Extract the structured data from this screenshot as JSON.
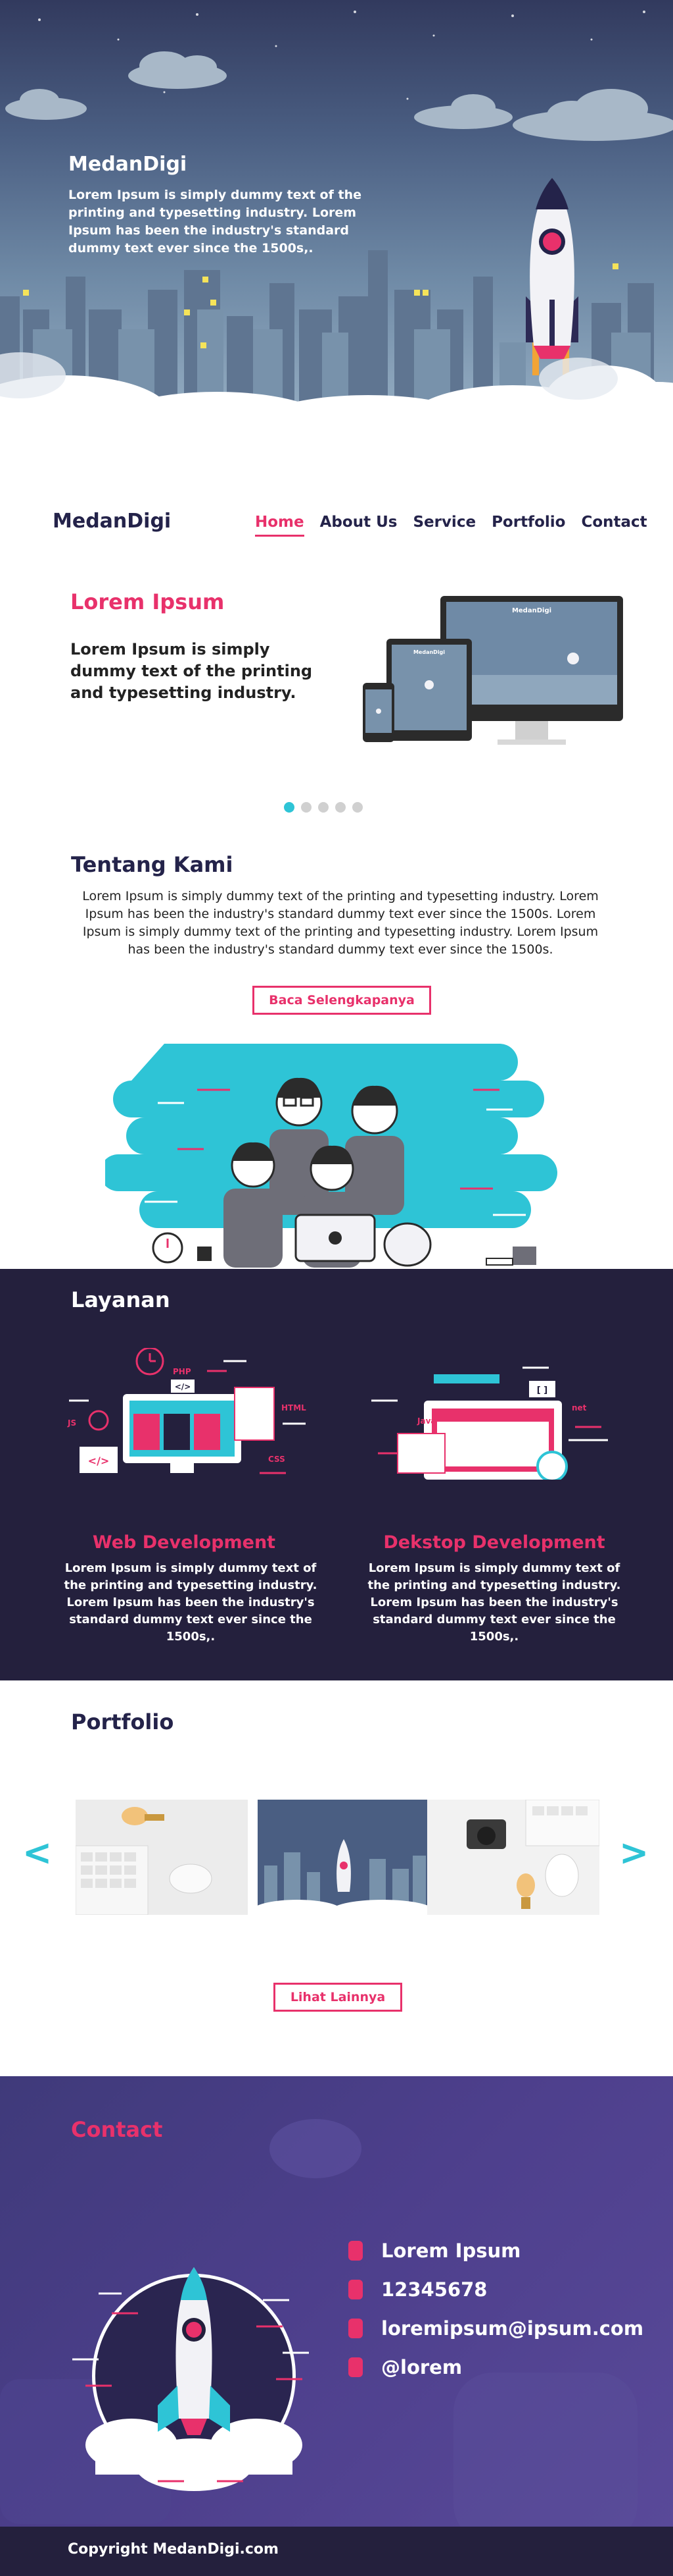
{
  "hero": {
    "brand": "MedanDigi",
    "text": "Lorem Ipsum is simply dummy text of the printing and typesetting industry. Lorem Ipsum has been the industry's standard dummy text ever since the 1500s,."
  },
  "nav": {
    "logo": "MedanDigi",
    "items": [
      "Home",
      "About Us",
      "Service",
      "Portfolio",
      "Contact"
    ],
    "active": "Home"
  },
  "slider": {
    "title": "Lorem Ipsum",
    "text": "Lorem Ipsum is simply dummy text of the printing and typesetting industry.",
    "slide_count": 5,
    "active_slide": 1,
    "device_screen_title": "MedanDigi"
  },
  "about": {
    "title": "Tentang Kami",
    "text": "Lorem Ipsum is simply dummy text of the printing and typesetting industry. Lorem Ipsum has been the industry's standard dummy text ever since the 1500s. Lorem Ipsum is simply dummy text of the printing and typesetting industry. Lorem Ipsum has been the industry's standard dummy text ever since the 1500s.",
    "button": "Baca Selengkapanya"
  },
  "services": {
    "title": "Layanan",
    "items": [
      {
        "title": "Web Development",
        "text": "Lorem Ipsum is simply dummy text of the printing and typesetting industry. Lorem Ipsum has been the industry's standard dummy text ever since the 1500s,.",
        "tags": [
          "PHP",
          "HTML",
          "JS",
          "CSS",
          "</>"
        ]
      },
      {
        "title": "Dekstop Development",
        "text": "Lorem Ipsum is simply dummy text of the printing and typesetting industry. Lorem Ipsum has been the industry's standard dummy text ever since the 1500s,.",
        "tags": [
          "net",
          "Java",
          "[ ]"
        ]
      }
    ]
  },
  "portfolio": {
    "title": "Portfolio",
    "prev": "<",
    "next": ">",
    "button": "Lihat Lainnya"
  },
  "contact": {
    "title": "Contact",
    "items": [
      "Lorem Ipsum",
      "12345678",
      "loremipsum@ipsum.com",
      "@lorem"
    ]
  },
  "footer": {
    "copyright": "Copyright MedanDigi.com"
  },
  "colors": {
    "accent": "#e8316b",
    "dark": "#24203d",
    "navy": "#24234a",
    "teal": "#2ec4d6",
    "purple": "#4d3f8c"
  }
}
